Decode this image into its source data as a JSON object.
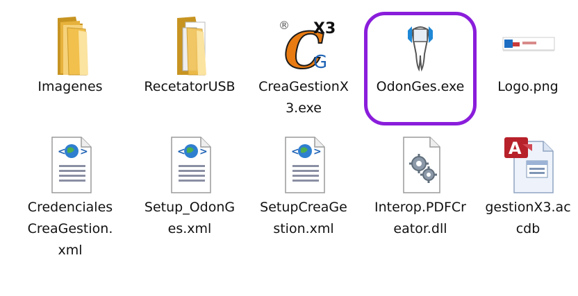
{
  "files": [
    {
      "name": "Imagenes",
      "icon": "folder-icon"
    },
    {
      "name": "RecetatorUSB",
      "icon": "folder-with-documents-icon"
    },
    {
      "name": "CreaGestionX3.exe",
      "icon": "creagestion-app-icon",
      "icon_text": {
        "registered": "®",
        "main": "C",
        "sup": "X3",
        "sub": "G"
      }
    },
    {
      "name": "OdonGes.exe",
      "icon": "tooth-app-icon",
      "highlighted": true
    },
    {
      "name": "Logo.png",
      "icon": "image-thumbnail-icon"
    },
    {
      "name": "CredencialesCreaGestion.xml",
      "icon": "xml-document-icon"
    },
    {
      "name": "Setup_OdonGes.xml",
      "icon": "xml-document-icon"
    },
    {
      "name": "SetupCreaGestion.xml",
      "icon": "xml-document-icon"
    },
    {
      "name": "Interop.PDFCreator.dll",
      "icon": "dll-gear-icon"
    },
    {
      "name": "gestionX3.accdb",
      "icon": "access-database-icon"
    }
  ],
  "colors": {
    "highlight": "#8a1ddb",
    "folder": "#f2c04d",
    "access_red": "#b7212a",
    "creagestion_orange": "#e87b12",
    "creagestion_blue": "#1f63b5"
  }
}
